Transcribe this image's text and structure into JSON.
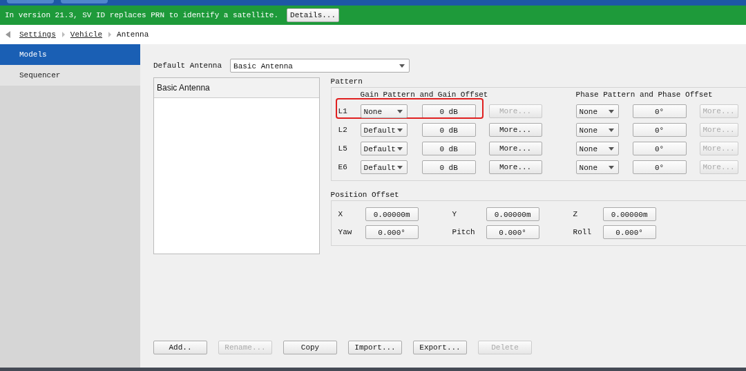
{
  "notice": {
    "text": "In version 21.3, SV ID replaces PRN to identify a satellite.",
    "button": "Details..."
  },
  "breadcrumb": [
    {
      "label": "Settings",
      "link": true
    },
    {
      "label": "Vehicle",
      "link": true
    },
    {
      "label": "Antenna",
      "link": false
    }
  ],
  "sidebar": {
    "items": [
      {
        "label": "Models",
        "selected": true
      },
      {
        "label": "Sequencer",
        "selected": false
      }
    ]
  },
  "default_antenna": {
    "label": "Default Antenna",
    "value": "Basic Antenna"
  },
  "antenna_list": {
    "items": [
      {
        "label": "Basic Antenna",
        "selected": false
      }
    ]
  },
  "pattern": {
    "title": "Pattern",
    "gain_heading": "Gain Pattern and Gain Offset",
    "phase_heading": "Phase Pattern and Phase Offset",
    "rows": [
      {
        "label": "L1",
        "gain_pattern": "None",
        "gain_offset": "0 dB",
        "gain_more": "More...",
        "gain_more_disabled": true,
        "phase_pattern": "None",
        "phase_offset": "0°",
        "phase_more": "More...",
        "phase_more_disabled": true,
        "highlighted": true
      },
      {
        "label": "L2",
        "gain_pattern": "Default",
        "gain_offset": "0 dB",
        "gain_more": "More...",
        "gain_more_disabled": false,
        "phase_pattern": "None",
        "phase_offset": "0°",
        "phase_more": "More...",
        "phase_more_disabled": true,
        "highlighted": false
      },
      {
        "label": "L5",
        "gain_pattern": "Default",
        "gain_offset": "0 dB",
        "gain_more": "More...",
        "gain_more_disabled": false,
        "phase_pattern": "None",
        "phase_offset": "0°",
        "phase_more": "More...",
        "phase_more_disabled": true,
        "highlighted": false
      },
      {
        "label": "E6",
        "gain_pattern": "Default",
        "gain_offset": "0 dB",
        "gain_more": "More...",
        "gain_more_disabled": false,
        "phase_pattern": "None",
        "phase_offset": "0°",
        "phase_more": "More...",
        "phase_more_disabled": true,
        "highlighted": false
      }
    ]
  },
  "position_offset": {
    "title": "Position Offset",
    "rows": [
      [
        {
          "label": "X",
          "value": "0.00000m"
        },
        {
          "label": "Y",
          "value": "0.00000m"
        },
        {
          "label": "Z",
          "value": "0.00000m"
        }
      ],
      [
        {
          "label": "Yaw",
          "value": "0.000°"
        },
        {
          "label": "Pitch",
          "value": "0.000°"
        },
        {
          "label": "Roll",
          "value": "0.000°"
        }
      ]
    ]
  },
  "buttons": [
    {
      "label": "Add..",
      "disabled": false
    },
    {
      "label": "Rename...",
      "disabled": true
    },
    {
      "label": "Copy",
      "disabled": false
    },
    {
      "label": "Import...",
      "disabled": false
    },
    {
      "label": "Export...",
      "disabled": false
    },
    {
      "label": "Delete",
      "disabled": true
    }
  ]
}
